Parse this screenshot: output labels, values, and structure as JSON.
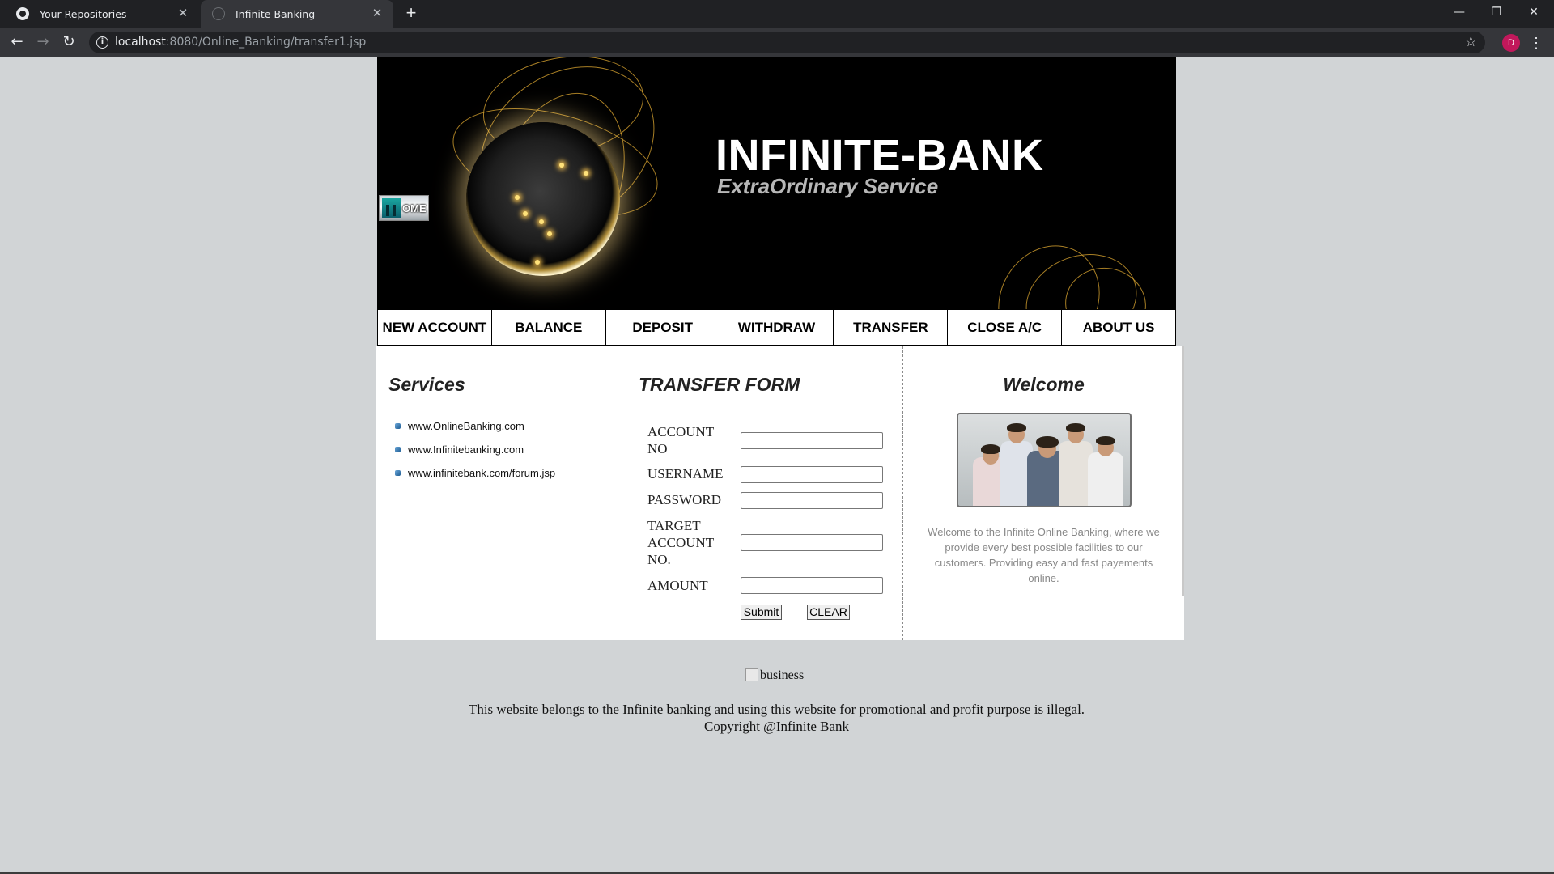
{
  "browser": {
    "tabs": [
      {
        "title": "Your Repositories",
        "icon": "github-icon",
        "active": false
      },
      {
        "title": "Infinite Banking",
        "icon": "globe-icon",
        "active": true
      }
    ],
    "new_tab": "+",
    "window_controls": {
      "minimize": "—",
      "restore": "❐",
      "close": "✕"
    },
    "url_host": "localhost",
    "url_rest": ":8080/Online_Banking/transfer1.jsp",
    "profile_initial": "D"
  },
  "banner": {
    "brand_name": "INFINITE-BANK",
    "tagline": "ExtraOrdinary Service",
    "home_label": "OME"
  },
  "nav": {
    "items": [
      "NEW ACCOUNT",
      "BALANCE",
      "DEPOSIT",
      "WITHDRAW",
      "TRANSFER",
      "CLOSE A/C",
      "ABOUT US"
    ]
  },
  "services": {
    "title": "Services",
    "links": [
      "www.OnlineBanking.com",
      "www.Infinitebanking.com",
      "www.infinitebank.com/forum.jsp"
    ]
  },
  "transfer_form": {
    "title": "TRANSFER FORM",
    "fields": [
      {
        "label": "ACCOUNT NO",
        "value": ""
      },
      {
        "label": "USERNAME",
        "value": ""
      },
      {
        "label": "PASSWORD",
        "value": ""
      },
      {
        "label": "TARGET ACCOUNT NO.",
        "value": ""
      },
      {
        "label": "AMOUNT",
        "value": ""
      }
    ],
    "submit_label": "Submit",
    "clear_label": "CLEAR"
  },
  "welcome": {
    "title": "Welcome",
    "text": "Welcome to the Infinite Online Banking, where we provide every best possible facilities to our customers. Providing easy and fast payements online."
  },
  "footer": {
    "image_alt": "business",
    "notice": "This website belongs to the Infinite banking and using this website for promotional and profit purpose is illegal.",
    "copyright": "Copyright @Infinite Bank"
  },
  "colors": {
    "page_bg": "#d1d4d6",
    "banner_bg": "#000000",
    "chrome_dark": "#202124",
    "chrome_toolbar": "#35363a"
  }
}
